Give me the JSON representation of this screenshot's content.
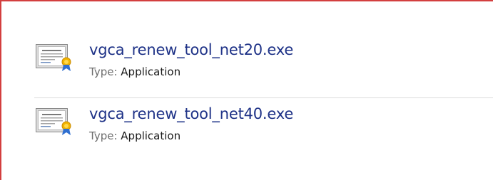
{
  "files": [
    {
      "name": "vgca_renew_tool_net20.exe",
      "type_label": "Type:",
      "type_value": "Application",
      "icon": "application-certificate-icon"
    },
    {
      "name": "vgca_renew_tool_net40.exe",
      "type_label": "Type:",
      "type_value": "Application",
      "icon": "application-certificate-icon"
    }
  ],
  "colors": {
    "frame_border": "#d33f3f",
    "file_name": "#1e3287",
    "type_label": "#6d6d6d",
    "divider": "#dcdcdc"
  }
}
